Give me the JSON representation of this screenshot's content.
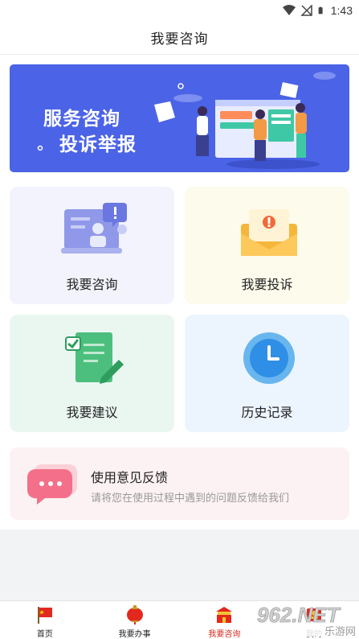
{
  "status_bar": {
    "time": "1:43"
  },
  "header": {
    "title": "我要咨询"
  },
  "banner": {
    "line1": "服务咨询",
    "line2": "投诉举报"
  },
  "cards": [
    {
      "label": "我要咨询",
      "icon": "consult-icon"
    },
    {
      "label": "我要投诉",
      "icon": "complaint-mail-icon"
    },
    {
      "label": "我要建议",
      "icon": "suggestion-document-icon"
    },
    {
      "label": "历史记录",
      "icon": "clock-icon"
    }
  ],
  "feedback": {
    "title": "使用意见反馈",
    "description": "请将您在使用过程中遇到的问题反馈给我们",
    "icon": "chat-bubble-icon"
  },
  "tabbar": {
    "tabs": [
      {
        "label": "首页",
        "icon": "flag-icon"
      },
      {
        "label": "我要办事",
        "icon": "lantern-icon"
      },
      {
        "label": "我要咨询",
        "icon": "gate-icon",
        "active": true
      },
      {
        "label": "我的",
        "icon": "profile-icon"
      }
    ]
  },
  "watermark": {
    "brand": "962.NET",
    "sub": "乐游网"
  },
  "colors": {
    "accent": "#d42a20",
    "banner": "#4b63e6"
  }
}
